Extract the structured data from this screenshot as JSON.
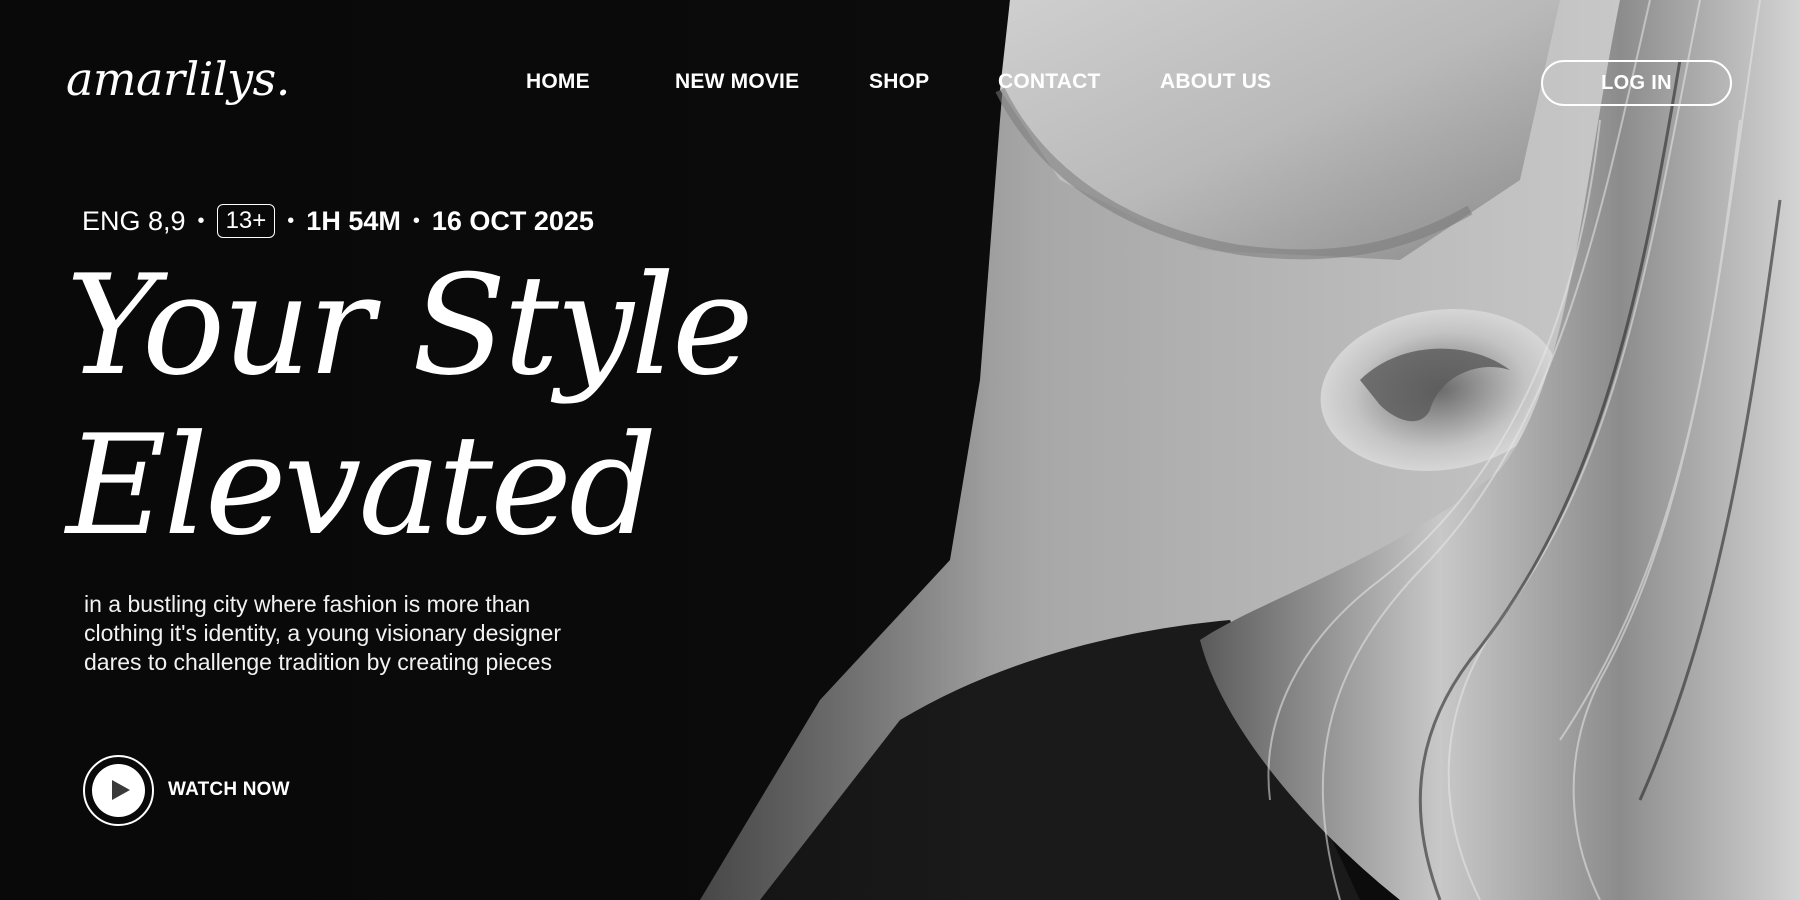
{
  "brand": {
    "logo_text": "amarlilys."
  },
  "nav": {
    "items": [
      {
        "label": "HOME"
      },
      {
        "label": "NEW MOVIE"
      },
      {
        "label": "SHOP"
      },
      {
        "label": "CONTACT"
      },
      {
        "label": "ABOUT US"
      }
    ],
    "login_label": "LOG IN"
  },
  "movie": {
    "language_rating": "ENG 8,9",
    "age_rating": "13+",
    "duration": "1H 54M",
    "release_date": "16 OCT 2025",
    "separator": "•",
    "title_lines": [
      "Your Style",
      "Elevated"
    ],
    "description_lines": [
      "in a bustling city where fashion is more than",
      "clothing it's identity, a young visionary designer",
      "dares to challenge tradition by creating pieces"
    ],
    "watch_label": "WATCH NOW"
  },
  "icons": {
    "play": "play-icon"
  },
  "colors": {
    "background": "#0c0c0c",
    "text": "#ffffff",
    "accent": "#ffffff"
  }
}
